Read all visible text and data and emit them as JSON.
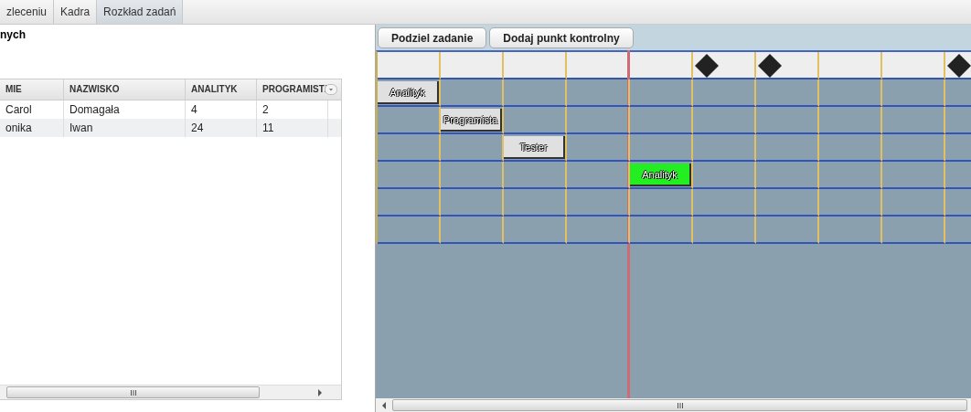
{
  "tabs": [
    {
      "label": "zleceniu",
      "selected": false
    },
    {
      "label": "Kadra",
      "selected": false
    },
    {
      "label": "Rozkład zadań",
      "selected": true
    }
  ],
  "left_panel": {
    "heading": "nych",
    "table": {
      "columns": [
        "MIE",
        "NAZWISKO",
        "ANALITYK",
        "PROGRAMIST/"
      ],
      "rows": [
        [
          "Carol",
          "Domagała",
          "4",
          "2"
        ],
        [
          "onika",
          "Iwan",
          "24",
          "11"
        ]
      ]
    }
  },
  "gantt": {
    "buttons": [
      "Podziel zadanie",
      "Dodaj punkt kontrolny"
    ],
    "columns": [
      {
        "milestone": false
      },
      {
        "milestone": false
      },
      {
        "milestone": false
      },
      {
        "milestone": false
      },
      {
        "milestone": false
      },
      {
        "milestone": true
      },
      {
        "milestone": true
      },
      {
        "milestone": false
      },
      {
        "milestone": false
      },
      {
        "milestone": true
      }
    ],
    "rows": [
      [
        {
          "task": "Analityk",
          "color": "#e0e0e0"
        },
        {},
        {},
        {},
        {},
        {},
        {},
        {},
        {},
        {}
      ],
      [
        {},
        {
          "task": "Programista",
          "color": "#e0e0e0"
        },
        {},
        {},
        {},
        {},
        {},
        {},
        {},
        {}
      ],
      [
        {},
        {},
        {
          "task": "Tester",
          "color": "#e0e0e0"
        },
        {},
        {},
        {},
        {},
        {},
        {},
        {}
      ],
      [
        {},
        {},
        {},
        {},
        {
          "task": "Analityk",
          "color": "#22ee22"
        },
        {},
        {},
        {},
        {},
        {}
      ],
      [
        {},
        {},
        {},
        {},
        {},
        {},
        {},
        {},
        {},
        {}
      ],
      [
        {},
        {},
        {},
        {},
        {},
        {},
        {},
        {},
        {},
        {}
      ]
    ]
  }
}
